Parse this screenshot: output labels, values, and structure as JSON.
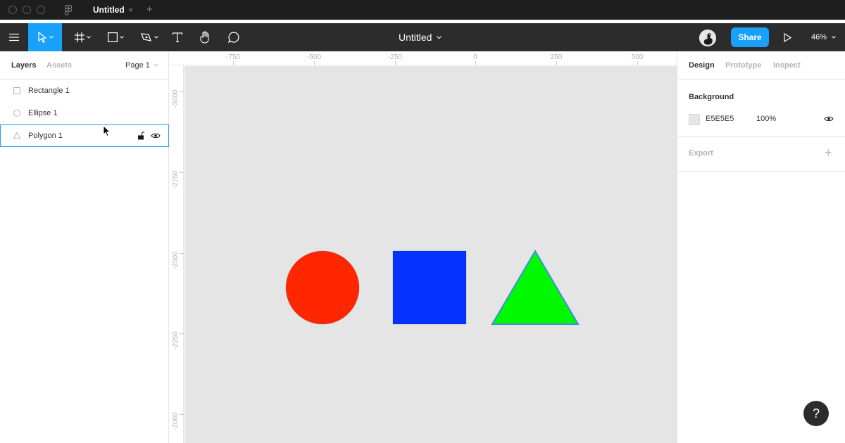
{
  "window": {
    "tab_title": "Untitled",
    "tab_close_glyph": "×",
    "tab_add_glyph": "+"
  },
  "toolbar": {
    "menu_icon": "hamburger-menu-icon",
    "tools": [
      "move-tool",
      "frame-tool",
      "rectangle-tool",
      "pen-tool",
      "text-tool",
      "hand-tool",
      "comment-tool"
    ],
    "active_tool": "move-tool",
    "file_title": "Untitled",
    "share_label": "Share",
    "zoom_label": "46%"
  },
  "left_panel": {
    "tabs": {
      "layers": "Layers",
      "assets": "Assets"
    },
    "page_select": "Page 1",
    "layers": [
      {
        "label": "Rectangle 1",
        "icon": "rectangle-icon",
        "selected": false
      },
      {
        "label": "Ellipse 1",
        "icon": "ellipse-icon",
        "selected": false
      },
      {
        "label": "Polygon 1",
        "icon": "polygon-icon",
        "selected": true
      }
    ]
  },
  "rulers": {
    "x_labels": [
      "-750",
      "-500",
      "-250",
      "0",
      "250",
      "500"
    ],
    "y_labels": [
      "-3000",
      "-2750",
      "-2500",
      "-2250",
      "-2000"
    ]
  },
  "canvas": {
    "background": "#E5E5E5",
    "shapes": [
      {
        "name": "ellipse",
        "fill": "#FF2600"
      },
      {
        "name": "rectangle",
        "fill": "#0433FF"
      },
      {
        "name": "polygon",
        "fill": "#00F900",
        "stroke": "#3D8FE0"
      }
    ]
  },
  "right_panel": {
    "tabs": {
      "design": "Design",
      "prototype": "Prototype",
      "inspect": "Inspect"
    },
    "background_title": "Background",
    "background_hex": "E5E5E5",
    "background_opacity": "100%",
    "export_title": "Export",
    "export_add_glyph": "+"
  },
  "help": {
    "label": "?"
  },
  "colors": {
    "accent": "#18A0FB",
    "toolbar": "#2C2C2C",
    "titlebar": "#1E1E1E"
  }
}
